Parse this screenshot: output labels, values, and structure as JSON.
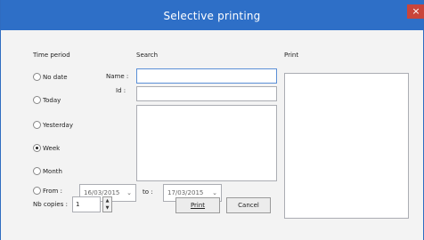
{
  "window": {
    "title": "Selective printing",
    "close_glyph": "×"
  },
  "time_period": {
    "header": "Time period",
    "options": [
      {
        "label": "No date",
        "checked": false
      },
      {
        "label": "Today",
        "checked": false
      },
      {
        "label": "Yesterday",
        "checked": false
      },
      {
        "label": "Week",
        "checked": true
      },
      {
        "label": "Month",
        "checked": false
      },
      {
        "label": "From :",
        "checked": false
      }
    ]
  },
  "search": {
    "header": "Search",
    "name_label": "Name :",
    "name_value": "",
    "id_label": "Id :",
    "id_value": ""
  },
  "date_range": {
    "from_value": "16/03/2015",
    "to_label": "to :",
    "to_value": "17/03/2015"
  },
  "print_section": {
    "header": "Print"
  },
  "copies": {
    "label": "Nb copies :",
    "value": "1"
  },
  "buttons": {
    "print_label": "Print",
    "cancel_label": "Cancel"
  },
  "icons": {
    "dropdown": "chevron-down-icon",
    "spinner": "up-down-arrows-icon",
    "close": "close-icon"
  }
}
